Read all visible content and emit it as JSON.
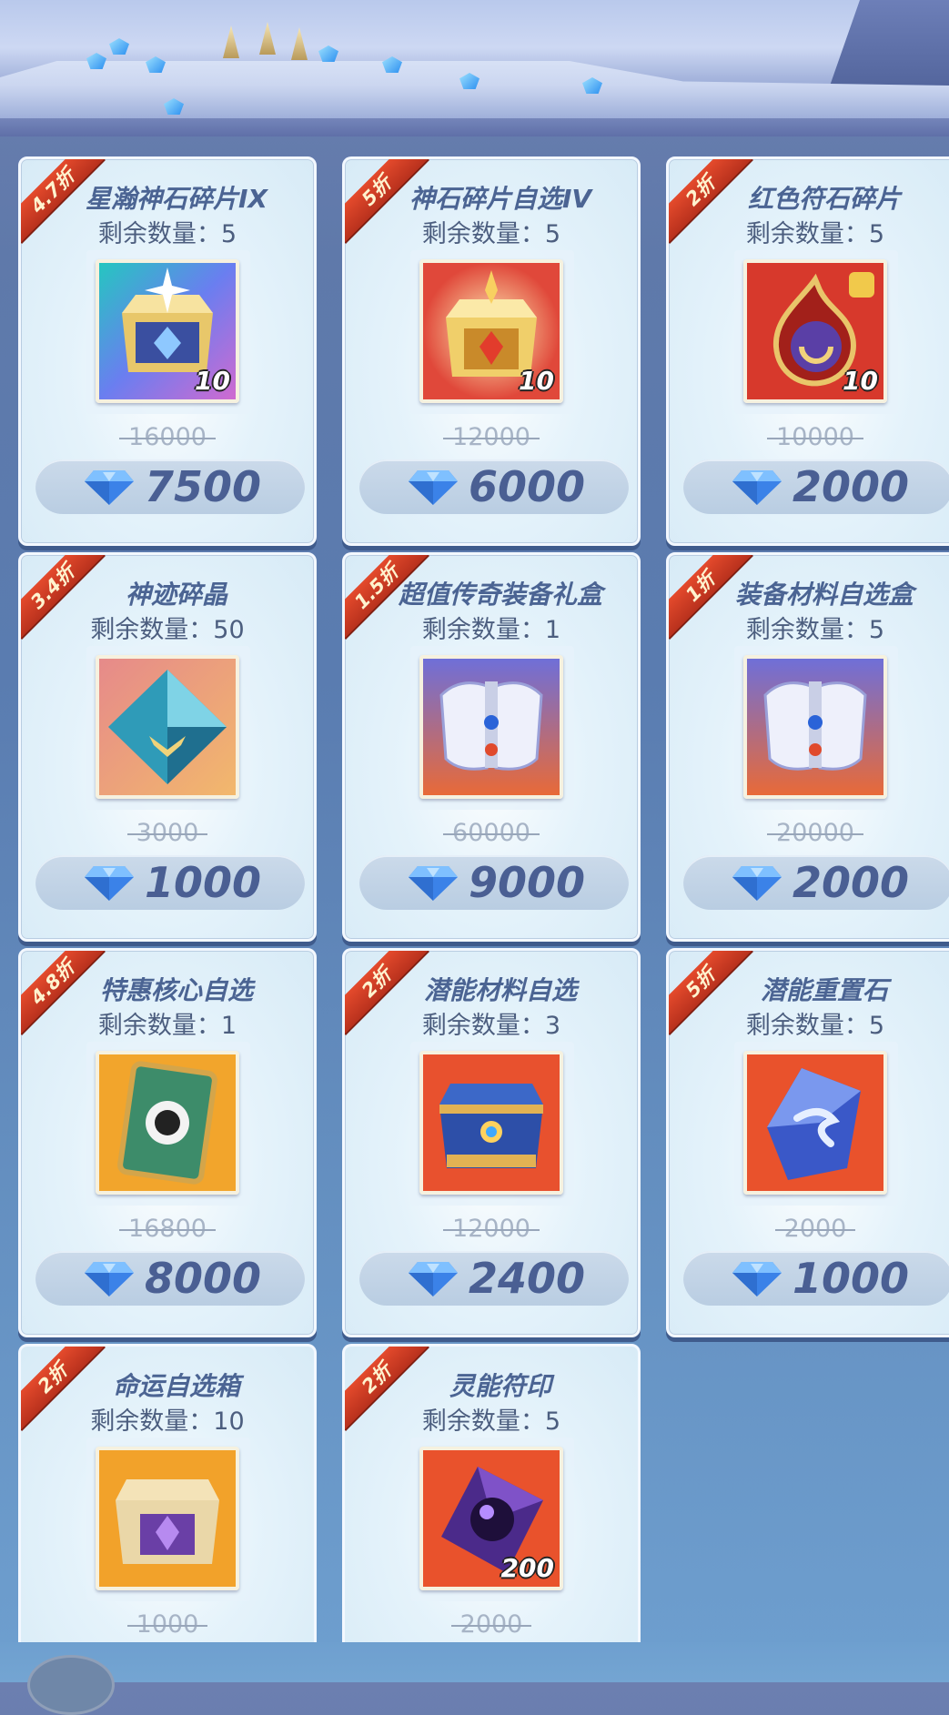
{
  "banner": {},
  "diamond_color": "#3b82e8",
  "ribbon_color": "#d63e25",
  "items": [
    {
      "discount": "4.7折",
      "title": "星瀚神石碎片IX",
      "stock": "剩余数量：5",
      "original": "16000",
      "price": "7500",
      "qty": "10",
      "icon": "crystal-chest-icon"
    },
    {
      "discount": "5折",
      "title": "神石碎片自选IV",
      "stock": "剩余数量：5",
      "original": "12000",
      "price": "6000",
      "qty": "10",
      "icon": "golden-chest-icon"
    },
    {
      "discount": "2折",
      "title": "红色符石碎片",
      "stock": "剩余数量：5",
      "original": "10000",
      "price": "2000",
      "qty": "10",
      "icon": "red-rune-icon"
    },
    {
      "discount": "3.4折",
      "title": "神迹碎晶",
      "stock": "剩余数量：50",
      "original": "3000",
      "price": "1000",
      "qty": "",
      "icon": "blue-crystal-icon"
    },
    {
      "discount": "1.5折",
      "title": "超值传奇装备礼盒",
      "stock": "剩余数量：1",
      "original": "60000",
      "price": "9000",
      "qty": "",
      "icon": "armor-set-icon"
    },
    {
      "discount": "1折",
      "title": "装备材料自选盒",
      "stock": "剩余数量：5",
      "original": "20000",
      "price": "2000",
      "qty": "",
      "icon": "armor-set-icon"
    },
    {
      "discount": "4.8折",
      "title": "特惠核心自选",
      "stock": "剩余数量：1",
      "original": "16800",
      "price": "8000",
      "qty": "",
      "icon": "card-icon"
    },
    {
      "discount": "2折",
      "title": "潜能材料自选",
      "stock": "剩余数量：3",
      "original": "12000",
      "price": "2400",
      "qty": "",
      "icon": "blue-chest-icon"
    },
    {
      "discount": "5折",
      "title": "潜能重置石",
      "stock": "剩余数量：5",
      "original": "2000",
      "price": "1000",
      "qty": "",
      "icon": "reset-stone-icon"
    },
    {
      "discount": "2折",
      "title": "命运自选箱",
      "stock": "剩余数量：10",
      "original": "1000",
      "price": "",
      "qty": "",
      "icon": "fate-chest-icon"
    },
    {
      "discount": "2折",
      "title": "灵能符印",
      "stock": "剩余数量：5",
      "original": "2000",
      "price": "",
      "qty": "200",
      "icon": "psionic-seal-icon"
    }
  ]
}
